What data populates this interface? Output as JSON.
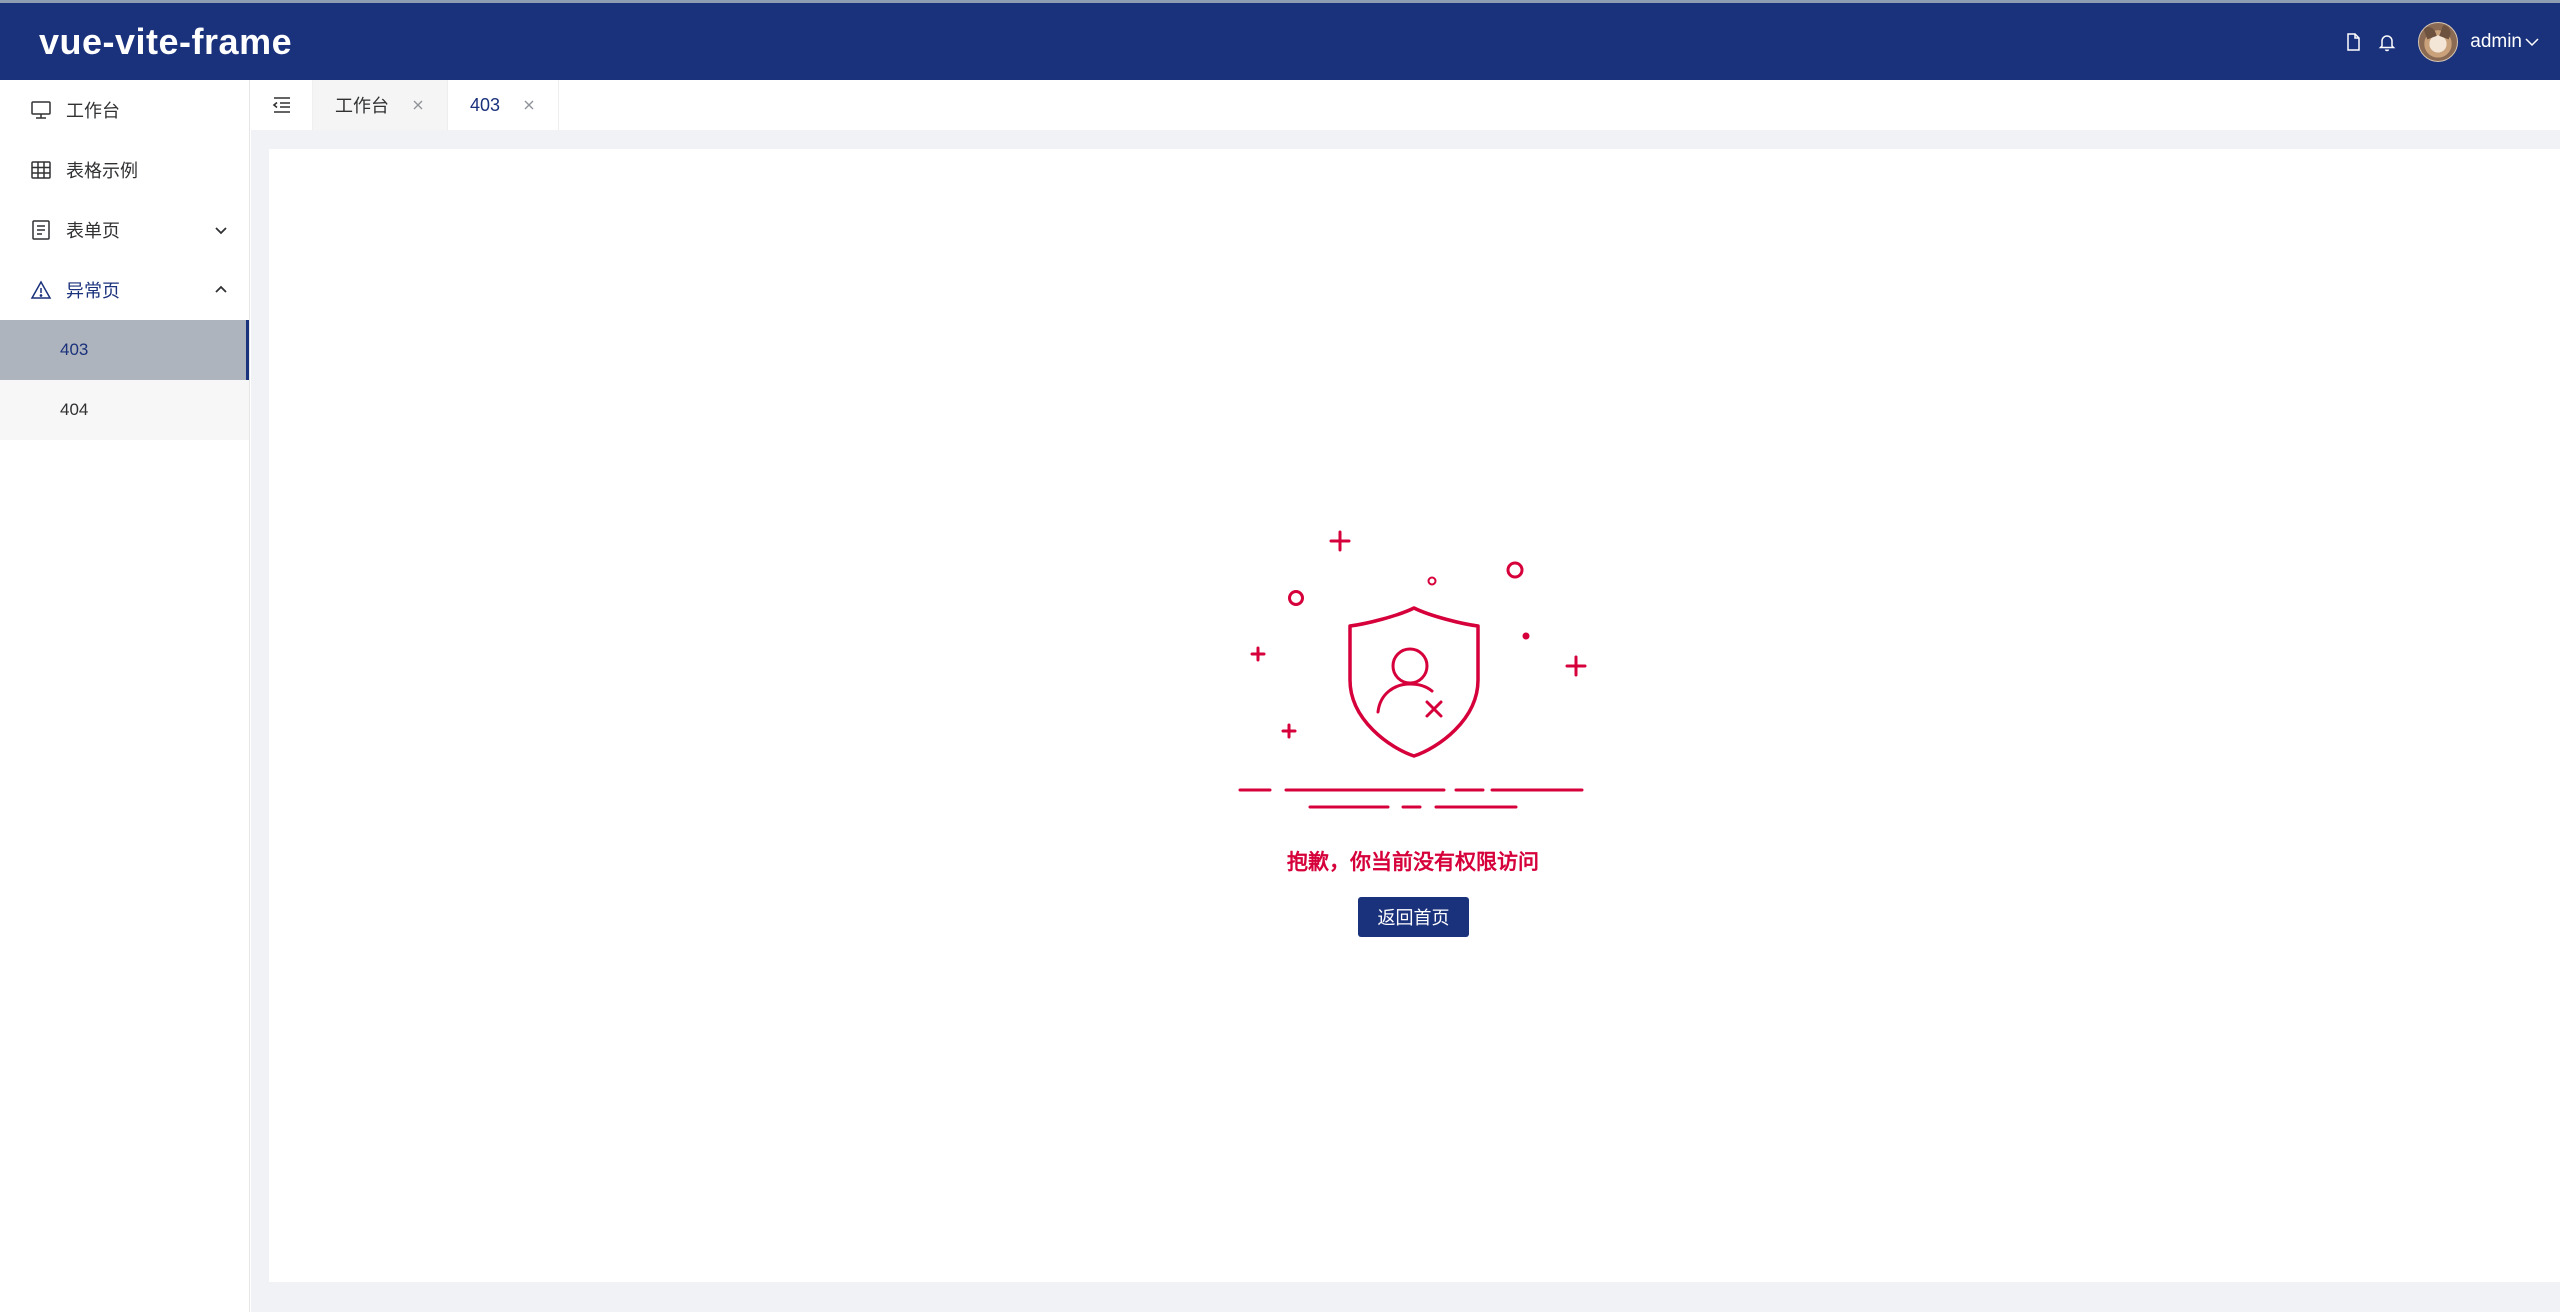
{
  "header": {
    "title": "vue-vite-frame",
    "icons": [
      "document-icon",
      "bell-icon"
    ],
    "user": {
      "name": "admin"
    }
  },
  "sidebar": {
    "items": [
      {
        "label": "工作台",
        "icon": "monitor-icon"
      },
      {
        "label": "表格示例",
        "icon": "table-icon"
      },
      {
        "label": "表单页",
        "icon": "form-icon",
        "expandable": true,
        "expanded": false
      },
      {
        "label": "异常页",
        "icon": "warning-icon",
        "expandable": true,
        "expanded": true,
        "children": [
          {
            "label": "403",
            "active": true
          },
          {
            "label": "404",
            "active": false
          }
        ]
      }
    ]
  },
  "tabs": [
    {
      "label": "工作台",
      "active": false
    },
    {
      "label": "403",
      "active": true
    }
  ],
  "main": {
    "error_message": "抱歉，你当前没有权限访问",
    "home_button": "返回首页"
  },
  "colors": {
    "brand": "#1a317b",
    "error": "#d6003b",
    "background": "#f0f2f5"
  }
}
